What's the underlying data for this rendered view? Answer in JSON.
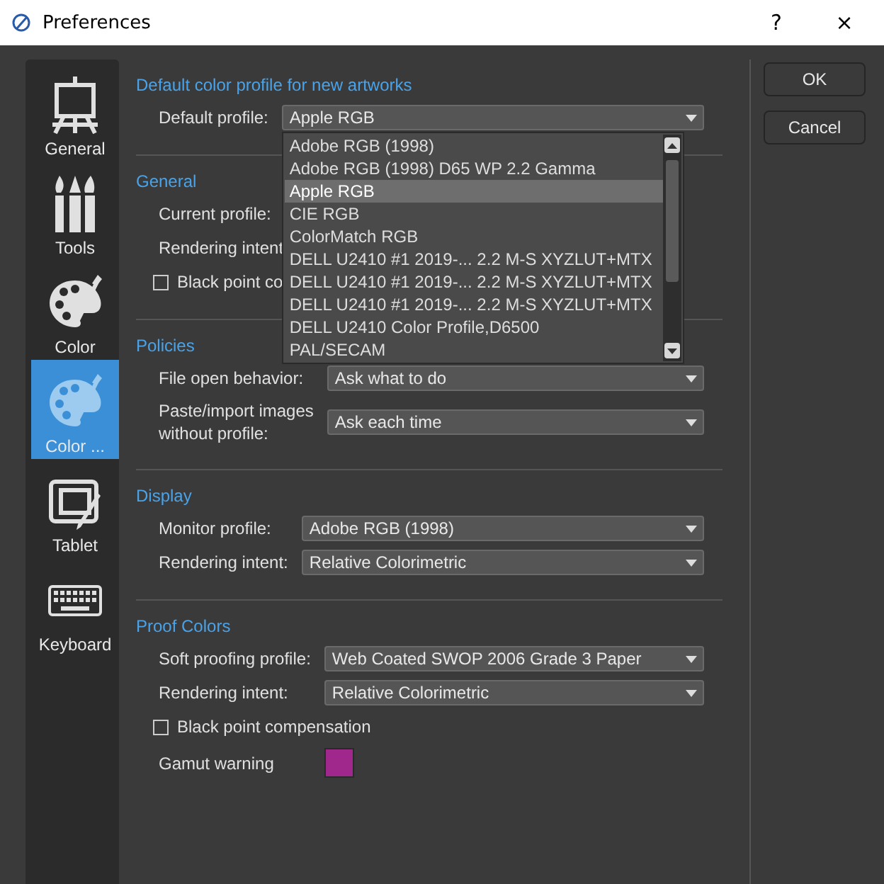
{
  "window": {
    "title": "Preferences",
    "help": "?",
    "close": "×"
  },
  "sidebar": {
    "items": [
      {
        "label": "General",
        "kind": "easel",
        "selected": false
      },
      {
        "label": "Tools",
        "kind": "brushes",
        "selected": false
      },
      {
        "label": "Color",
        "kind": "palette",
        "selected": false
      },
      {
        "label": "Color ...",
        "kind": "palette",
        "selected": true
      },
      {
        "label": "Tablet",
        "kind": "tablet",
        "selected": false
      },
      {
        "label": "Keyboard",
        "kind": "keyboard",
        "selected": false
      }
    ]
  },
  "sections": [
    {
      "title": "Default color profile for new artworks",
      "rows": [
        {
          "kind": "select",
          "label": "Default profile:",
          "value": "Apple RGB",
          "open": true,
          "options": [
            {
              "label": "Adobe RGB (1998)",
              "selected": false
            },
            {
              "label": "Adobe RGB (1998) D65 WP 2.2 Gamma",
              "selected": false
            },
            {
              "label": "Apple RGB",
              "selected": true
            },
            {
              "label": "CIE RGB",
              "selected": false
            },
            {
              "label": "ColorMatch RGB",
              "selected": false
            },
            {
              "label": "DELL U2410 #1 2019-... 2.2 M-S XYZLUT+MTX",
              "selected": false
            },
            {
              "label": "DELL U2410 #1 2019-... 2.2 M-S XYZLUT+MTX",
              "selected": false
            },
            {
              "label": "DELL U2410 #1 2019-... 2.2 M-S XYZLUT+MTX",
              "selected": false
            },
            {
              "label": "DELL U2410 Color Profile,D6500",
              "selected": false
            },
            {
              "label": "PAL/SECAM",
              "selected": false
            }
          ]
        }
      ]
    },
    {
      "title": "General",
      "rows": [
        {
          "kind": "label",
          "label": "Current profile:"
        },
        {
          "kind": "label",
          "label": "Rendering intent"
        },
        {
          "kind": "checkbox",
          "label": "Black point co",
          "checked": false
        }
      ]
    },
    {
      "title": "Policies",
      "rows": [
        {
          "kind": "select",
          "label": "File open behavior:",
          "value": "Ask what to do"
        },
        {
          "kind": "select",
          "label": "Paste/import images\nwithout profile:",
          "value": "Ask each time"
        }
      ]
    },
    {
      "title": "Display",
      "rows": [
        {
          "kind": "select",
          "label": "Monitor profile:",
          "value": "Adobe RGB (1998)"
        },
        {
          "kind": "select",
          "label": "Rendering intent:",
          "value": "Relative Colorimetric"
        }
      ]
    },
    {
      "title": "Proof Colors",
      "rows": [
        {
          "kind": "select",
          "label": "Soft proofing profile:",
          "value": "Web Coated SWOP 2006 Grade 3 Paper"
        },
        {
          "kind": "select",
          "label": "Rendering intent:",
          "value": "Relative Colorimetric"
        },
        {
          "kind": "checkbox",
          "label": "Black point compensation",
          "checked": false
        },
        {
          "kind": "color",
          "label": "Gamut warning",
          "color": "#a0288c"
        }
      ]
    }
  ],
  "buttons": [
    "OK",
    "Cancel"
  ]
}
